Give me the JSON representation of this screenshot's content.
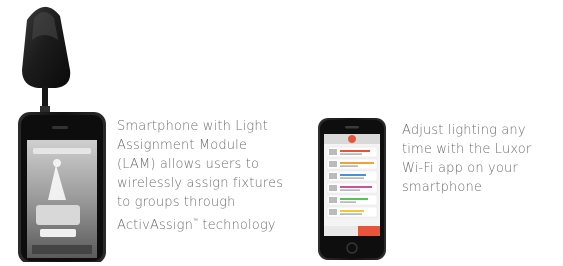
{
  "captions": {
    "lam": {
      "lines": [
        "Smartphone with Light",
        "Assignment Module",
        "(LAM) allows users to",
        "wirelessly assign fixtures",
        "to groups through",
        "ActivAssign"
      ],
      "trademark": "™",
      "line_end": " technology"
    },
    "app": {
      "lines": [
        "Adjust lighting any",
        "time with the Luxor",
        "Wi-Fi app on your",
        "smartphone"
      ]
    }
  },
  "colors": {
    "caption_text": "#6e6e6e",
    "device_body": "#1a1a1a",
    "app_accent": "#e8543a"
  }
}
